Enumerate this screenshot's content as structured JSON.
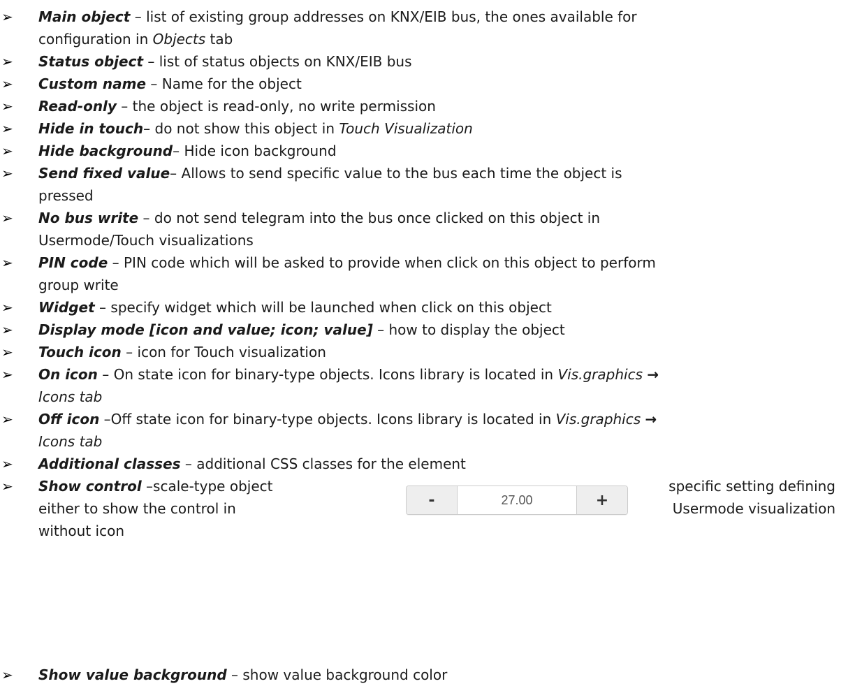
{
  "bullet": "➢",
  "items": [
    {
      "term": "Main object",
      "text": " – list of existing group addresses on KNX/EIB bus, the ones available for",
      "line2": "configuration in ",
      "line2_italic": "Objects",
      "line2_rest": " tab"
    },
    {
      "term": "Status object",
      "text": " – list of status objects on KNX/EIB bus"
    },
    {
      "term": "Custom name",
      "text": " – Name for the object"
    },
    {
      "term": "Read-only",
      "text": " – the object is read-only, no write permission"
    },
    {
      "term": "Hide in touch",
      "text": "– do not show this object in ",
      "italic": "Touch Visualization"
    },
    {
      "term": "Hide background",
      "text": "– Hide icon background"
    },
    {
      "term": "Send fixed value",
      "text": "– Allows to send specific value to the bus each time the object is",
      "line2": "pressed"
    },
    {
      "term": "No bus write",
      "text": " – do not send telegram into the bus once clicked on this object in",
      "line2": "Usermode/Touch visualizations"
    },
    {
      "term": "PIN code",
      "text": " – PIN code which will be asked to provide when click on this object to perform",
      "line2": "group write"
    },
    {
      "term": "Widget",
      "text": " – specify widget which will be launched when click on this object"
    },
    {
      "term": "Display mode [icon and value; icon; value]",
      "text": " – how to display the object"
    },
    {
      "term": "Touch icon",
      "text": " – icon for Touch visualization"
    },
    {
      "term": "On icon",
      "text": " – On state icon for binary-type objects. Icons library is located in ",
      "italic": "Vis.graphics",
      "arrow": "→",
      "line2_italic": "Icons tab"
    },
    {
      "term": "Off icon",
      "text": " –Off state icon for binary-type objects. Icons library is located in ",
      "italic": "Vis.graphics",
      "arrow": "→",
      "line2_italic": "Icons tab"
    },
    {
      "term": "Additional classes",
      "text": " – additional CSS classes for the element"
    },
    {
      "term": "Show control",
      "text": " –scale-type object",
      "right1": "specific setting defining",
      "line2": "either to show the control in",
      "right2": "Usermode visualization",
      "line3": "without icon"
    },
    {
      "term": "Show value background",
      "text": " – show value background color"
    }
  ],
  "stepper": {
    "minus": "-",
    "value": "27.00",
    "plus": "+"
  }
}
